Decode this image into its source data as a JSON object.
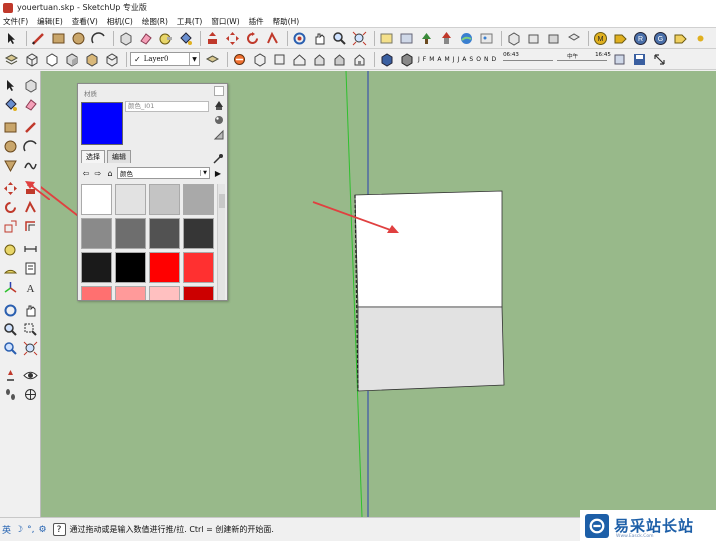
{
  "window": {
    "title": "youertuan.skp - SketchUp 专业版"
  },
  "menu": [
    "文件(F)",
    "编辑(E)",
    "查看(V)",
    "相机(C)",
    "绘图(R)",
    "工具(T)",
    "窗口(W)",
    "插件",
    "帮助(H)"
  ],
  "layers": {
    "current": "Layer0"
  },
  "shadow": {
    "months": [
      "J",
      "F",
      "M",
      "A",
      "M",
      "J",
      "J",
      "A",
      "S",
      "O",
      "N",
      "D"
    ],
    "time_start": "06:43",
    "time_mid": "中午",
    "time_end": "16:45"
  },
  "materials": {
    "panel_title": "材质",
    "current_name": "颜色_I01",
    "current_color": "#0000ff",
    "tabs": [
      "选择",
      "编辑"
    ],
    "category": "颜色",
    "swatches": [
      "#ffffff",
      "#e2e2e2",
      "#c4c4c4",
      "#a9a9a9",
      "#8a8a8a",
      "#6e6e6e",
      "#525252",
      "#363636",
      "#1a1a1a",
      "#000000",
      "#ff0000",
      "#ff3030",
      "#ff7070",
      "#ff9a9a",
      "#ffc0c0",
      "#cc0000"
    ]
  },
  "status": {
    "ime_lang": "英",
    "hint": "通过拖动或是输入数值进行推/拉. Ctrl = 创建新的开始面."
  },
  "watermark": {
    "text": "易采站长站",
    "sub": "Www.Easck.Com"
  },
  "colors": {
    "canvas_bg": "#98b98a",
    "annotation_arrow": "#e04040",
    "green_axis": "#2ec02e",
    "blue_axis": "#2a3fb0"
  }
}
